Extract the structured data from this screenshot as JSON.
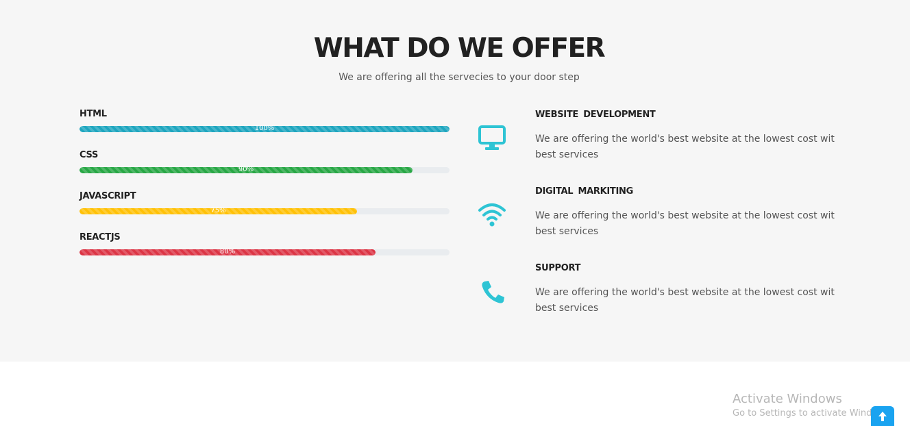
{
  "header": {
    "title": "WHAT DO WE OFFER",
    "subtitle": "We are offering all the servecies to your door step"
  },
  "skills": [
    {
      "name": "HTML",
      "percent": 100,
      "label": "100%",
      "color": "#1fa6bf"
    },
    {
      "name": "CSS",
      "percent": 90,
      "label": "90%",
      "color": "#28a745"
    },
    {
      "name": "JAVASCRIPT",
      "percent": 75,
      "label": "75%",
      "color": "#ffc107"
    },
    {
      "name": "REACTJS",
      "percent": 80,
      "label": "80%",
      "color": "#dc3545"
    }
  ],
  "services": [
    {
      "title": "WEBSITE  DEVELOPMENT",
      "description": "We are offering the world's best website at the lowest cost wit best services",
      "icon": "monitor-icon"
    },
    {
      "title": "DIGITAL  MARKITING",
      "description": "We are offering the world's best website at the lowest cost wit best services",
      "icon": "wifi-icon"
    },
    {
      "title": "SUPPORT",
      "description": "We are offering the world's best website at the lowest cost wit best services",
      "icon": "phone-icon"
    }
  ],
  "icon_color": "#2ec4d4",
  "watermark": {
    "title": "Activate Windows",
    "subtitle": "Go to Settings to activate Windows."
  },
  "scroll_top": {
    "icon": "arrow-up-icon",
    "color": "#1aa3f0"
  }
}
